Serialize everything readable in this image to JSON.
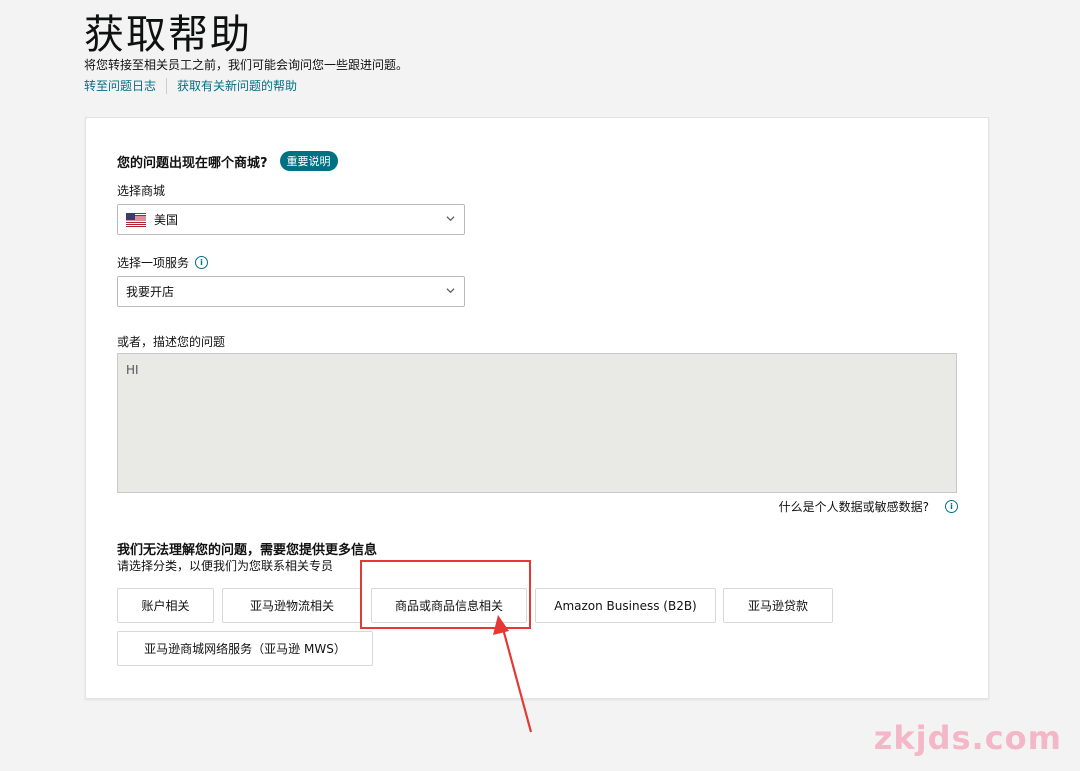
{
  "header": {
    "title": "获取帮助",
    "subtitle": "将您转接至相关员工之前，我们可能会询问您一些跟进问题。",
    "links": [
      "转至问题日志",
      "获取有关新问题的帮助"
    ]
  },
  "form": {
    "question_title": "您的问题出现在哪个商城?",
    "important_badge": "重要说明",
    "marketplace_label": "选择商城",
    "marketplace_value": "美国",
    "service_label": "选择一项服务",
    "service_value": "我要开店",
    "describe_label": "或者，描述您的问题",
    "describe_value": "HI",
    "privacy_link": "什么是个人数据或敏感数据?"
  },
  "categories": {
    "title": "我们无法理解您的问题，需要您提供更多信息",
    "subtitle": "请选择分类，以便我们为您联系相关专员",
    "buttons": [
      "账户相关",
      "亚马逊物流相关",
      "商品或商品信息相关",
      "Amazon Business (B2B)",
      "亚马逊贷款",
      "亚马逊商城网络服务（亚马逊 MWS）"
    ]
  },
  "annotation": {
    "highlight_color": "#e53935"
  },
  "watermark": "zkjds.com",
  "colors": {
    "link": "#007185",
    "badge": "#007185",
    "textarea_bg": "#e9e9e6"
  }
}
